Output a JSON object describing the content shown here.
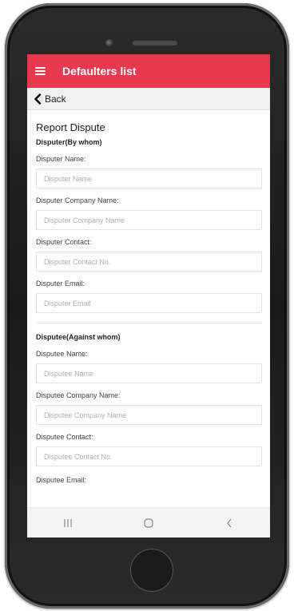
{
  "header": {
    "title": "Defaulters list"
  },
  "back": {
    "label": "Back"
  },
  "form": {
    "title": "Report Dispute",
    "disputer": {
      "section_title": "Disputer(By whom)",
      "name_label": "Disputer Name:",
      "name_placeholder": "Disputer Name",
      "company_label": "Disputer Company Name:",
      "company_placeholder": "Disputer Company Name",
      "contact_label": "Disputer Contact:",
      "contact_placeholder": "Disputer Contact No.",
      "email_label": "Disputer Email:",
      "email_placeholder": "Disputer Email"
    },
    "disputee": {
      "section_title": "Disputee(Against whom)",
      "name_label": "Disputee Name:",
      "name_placeholder": "Disputee Name",
      "company_label": "Disputee Company Name:",
      "company_placeholder": "Disputee Company Name",
      "contact_label": "Disputee Contact:",
      "contact_placeholder": "Disputee Contact No.",
      "email_label": "Disputee Email:"
    }
  },
  "navbar": {
    "recents_icon": "recents-icon",
    "home_icon": "home-icon",
    "back_icon": "back-icon"
  },
  "colors": {
    "accent": "#e83a4f"
  }
}
